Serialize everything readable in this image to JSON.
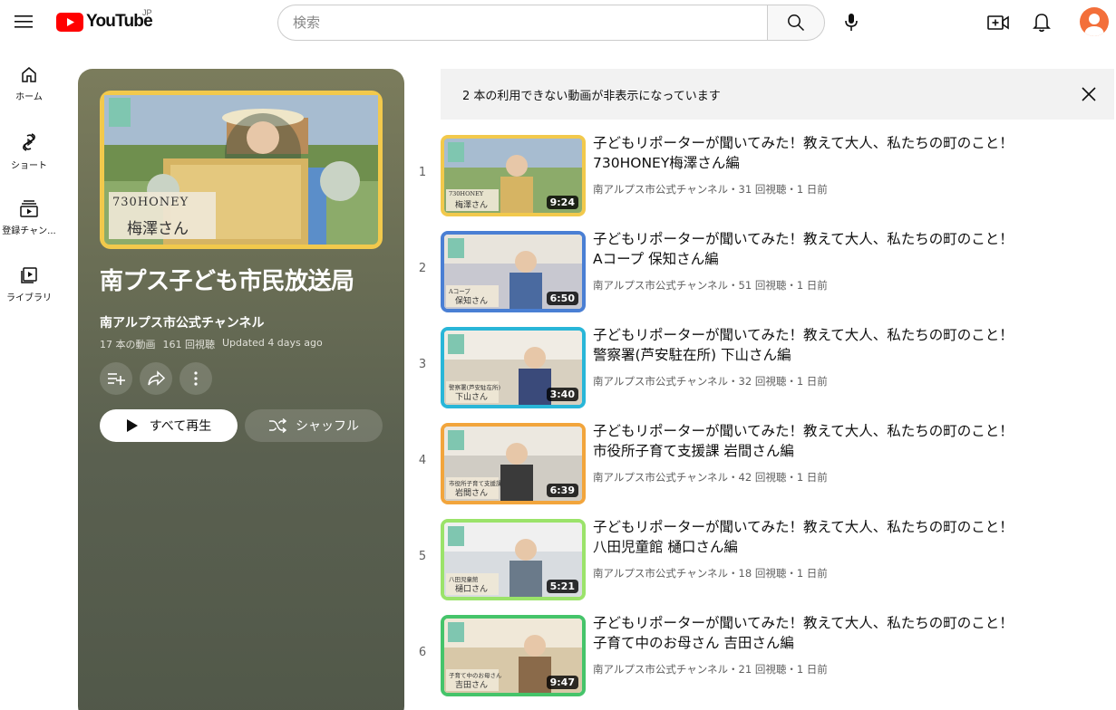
{
  "header": {
    "logo_text": "YouTube",
    "country": "JP",
    "search_placeholder": "検索"
  },
  "leftnav": {
    "items": [
      {
        "label": "ホーム",
        "icon": "home-icon"
      },
      {
        "label": "ショート",
        "icon": "shorts-icon"
      },
      {
        "label": "登録チャン...",
        "icon": "subscriptions-icon"
      },
      {
        "label": "ライブラリ",
        "icon": "library-icon"
      }
    ]
  },
  "playlist": {
    "title": "南プス子ども市民放送局",
    "channel": "南アルプス市公式チャンネル",
    "video_count": "17 本の動画",
    "views": "161 回視聴",
    "updated": "Updated 4 days ago",
    "play_all_label": "すべて再生",
    "shuffle_label": "シャッフル",
    "thumb_caption_top": "730HONEY",
    "thumb_caption_bottom": "梅澤さん"
  },
  "notice": {
    "text": "2 本の利用できない動画が非表示になっています"
  },
  "videos": [
    {
      "index": "1",
      "title_line1": "子どもリポーターが聞いてみた！教えて大人、私たちの町のこと！",
      "title_line2": "730HONEY梅澤さん編",
      "meta": "南アルプス市公式チャンネル・31 回視聴・1 日前",
      "duration": "9:24",
      "caption_top": "730HONEY",
      "caption_bottom": "梅澤さん",
      "border": "#f2c94c"
    },
    {
      "index": "2",
      "title_line1": "子どもリポーターが聞いてみた！教えて大人、私たちの町のこと！",
      "title_line2": "Aコープ 保知さん編",
      "meta": "南アルプス市公式チャンネル・51 回視聴・1 日前",
      "duration": "6:50",
      "caption_top": "Aコープ",
      "caption_bottom": "保知さん",
      "border": "#4a7fd4"
    },
    {
      "index": "3",
      "title_line1": "子どもリポーターが聞いてみた！教えて大人、私たちの町のこと！",
      "title_line2": "警察署(芦安駐在所) 下山さん編",
      "meta": "南アルプス市公式チャンネル・32 回視聴・1 日前",
      "duration": "3:40",
      "caption_top": "警察署(芦安駐在所)",
      "caption_bottom": "下山さん",
      "border": "#29b6d8"
    },
    {
      "index": "4",
      "title_line1": "子どもリポーターが聞いてみた！教えて大人、私たちの町のこと！",
      "title_line2": "市役所子育て支援課 岩間さん編",
      "meta": "南アルプス市公式チャンネル・42 回視聴・1 日前",
      "duration": "6:39",
      "caption_top": "市役所子育て支援課",
      "caption_bottom": "岩間さん",
      "border": "#f2a53c"
    },
    {
      "index": "5",
      "title_line1": "子どもリポーターが聞いてみた！教えて大人、私たちの町のこと！",
      "title_line2": "八田児童館 樋口さん編",
      "meta": "南アルプス市公式チャンネル・18 回視聴・1 日前",
      "duration": "5:21",
      "caption_top": "八田児童館",
      "caption_bottom": "樋口さん",
      "border": "#9be36a"
    },
    {
      "index": "6",
      "title_line1": "子どもリポーターが聞いてみた！教えて大人、私たちの町のこと！",
      "title_line2": "子育て中のお母さん 吉田さん編",
      "meta": "南アルプス市公式チャンネル・21 回視聴・1 日前",
      "duration": "9:47",
      "caption_top": "子育て中のお母さん",
      "caption_bottom": "吉田さん",
      "border": "#45c46a"
    }
  ]
}
